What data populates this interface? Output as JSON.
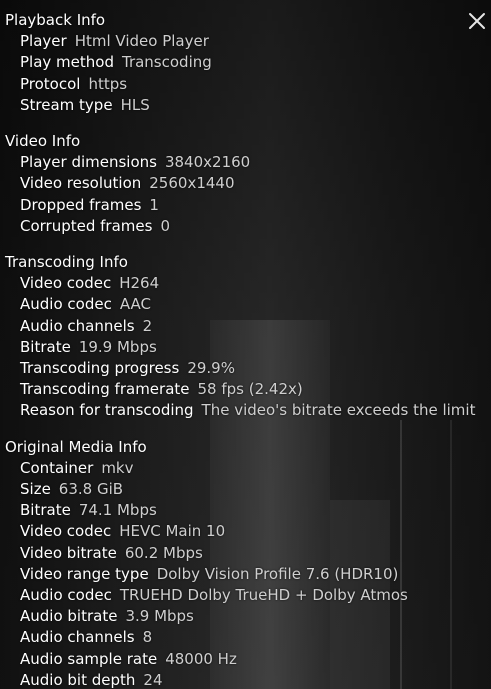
{
  "close_icon": "close-icon",
  "sections": [
    {
      "title": "Playback Info",
      "rows": [
        {
          "label": "Player",
          "value": "Html Video Player"
        },
        {
          "label": "Play method",
          "value": "Transcoding"
        },
        {
          "label": "Protocol",
          "value": "https"
        },
        {
          "label": "Stream type",
          "value": "HLS"
        }
      ]
    },
    {
      "title": "Video Info",
      "rows": [
        {
          "label": "Player dimensions",
          "value": "3840x2160"
        },
        {
          "label": "Video resolution",
          "value": "2560x1440"
        },
        {
          "label": "Dropped frames",
          "value": "1"
        },
        {
          "label": "Corrupted frames",
          "value": "0"
        }
      ]
    },
    {
      "title": "Transcoding Info",
      "rows": [
        {
          "label": "Video codec",
          "value": "H264"
        },
        {
          "label": "Audio codec",
          "value": "AAC"
        },
        {
          "label": "Audio channels",
          "value": "2"
        },
        {
          "label": "Bitrate",
          "value": "19.9 Mbps"
        },
        {
          "label": "Transcoding progress",
          "value": "29.9%"
        },
        {
          "label": "Transcoding framerate",
          "value": "58 fps (2.42x)"
        },
        {
          "label": "Reason for transcoding",
          "value": "The video's bitrate exceeds the limit"
        }
      ]
    },
    {
      "title": "Original Media Info",
      "rows": [
        {
          "label": "Container",
          "value": "mkv"
        },
        {
          "label": "Size",
          "value": "63.8 GiB"
        },
        {
          "label": "Bitrate",
          "value": "74.1 Mbps"
        },
        {
          "label": "Video codec",
          "value": "HEVC Main 10"
        },
        {
          "label": "Video bitrate",
          "value": "60.2 Mbps"
        },
        {
          "label": "Video range type",
          "value": "Dolby Vision Profile 7.6 (HDR10)"
        },
        {
          "label": "Audio codec",
          "value": "TRUEHD Dolby TrueHD + Dolby Atmos"
        },
        {
          "label": "Audio bitrate",
          "value": "3.9 Mbps"
        },
        {
          "label": "Audio channels",
          "value": "8"
        },
        {
          "label": "Audio sample rate",
          "value": "48000 Hz"
        },
        {
          "label": "Audio bit depth",
          "value": "24"
        }
      ]
    }
  ]
}
